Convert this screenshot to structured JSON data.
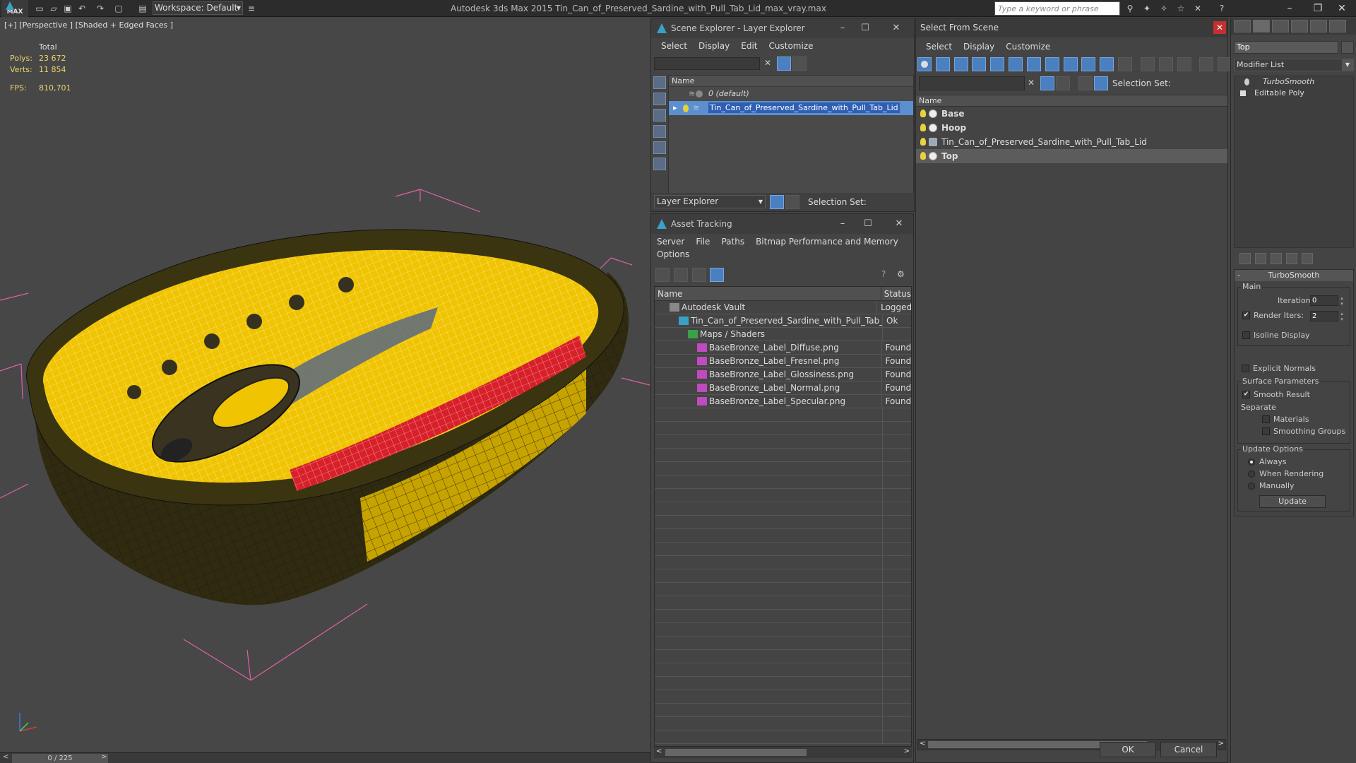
{
  "titlebar": {
    "app_name": "MAX",
    "workspace": "Workspace: Default",
    "title": "Autodesk 3ds Max  2015     Tin_Can_of_Preserved_Sardine_with_Pull_Tab_Lid_max_vray.max",
    "search_placeholder": "Type a keyword or phrase"
  },
  "viewport": {
    "label": "[+] [Perspective ] [Shaded + Edged Faces ]",
    "stats": {
      "total_label": "Total",
      "polys_label": "Polys:",
      "polys": "23 672",
      "verts_label": "Verts:",
      "verts": "11 854",
      "fps_label": "FPS:",
      "fps": "810,701"
    }
  },
  "timeslider": {
    "value": "0 / 225"
  },
  "scene_explorer": {
    "title": "Scene Explorer - Layer Explorer",
    "menu": [
      "Select",
      "Display",
      "Edit",
      "Customize"
    ],
    "col_name": "Name",
    "rows": [
      {
        "label": "0 (default)"
      },
      {
        "label": "Tin_Can_of_Preserved_Sardine_with_Pull_Tab_Lid"
      }
    ],
    "layer_dropdown": "Layer Explorer",
    "selection_set_label": "Selection Set:"
  },
  "asset_tracking": {
    "title": "Asset Tracking",
    "menu": [
      "Server",
      "File",
      "Paths",
      "Bitmap Performance and Memory"
    ],
    "menu2": "Options",
    "col_name": "Name",
    "col_status": "Status",
    "rows": [
      {
        "name": "Autodesk Vault",
        "status": "Logged",
        "indent": 1
      },
      {
        "name": "Tin_Can_of_Preserved_Sardine_with_Pull_Tab_Lid...",
        "status": "Ok",
        "indent": 2
      },
      {
        "name": "Maps / Shaders",
        "status": "",
        "indent": 3
      },
      {
        "name": "BaseBronze_Label_Diffuse.png",
        "status": "Found",
        "indent": 4
      },
      {
        "name": "BaseBronze_Label_Fresnel.png",
        "status": "Found",
        "indent": 4
      },
      {
        "name": "BaseBronze_Label_Glossiness.png",
        "status": "Found",
        "indent": 4
      },
      {
        "name": "BaseBronze_Label_Normal.png",
        "status": "Found",
        "indent": 4
      },
      {
        "name": "BaseBronze_Label_Specular.png",
        "status": "Found",
        "indent": 4
      }
    ]
  },
  "select_from_scene": {
    "title": "Select From Scene",
    "menu": [
      "Select",
      "Display",
      "Customize"
    ],
    "selection_set_label": "Selection Set:",
    "col_name": "Name",
    "rows": [
      {
        "label": "Base",
        "bold": true
      },
      {
        "label": "Hoop",
        "bold": true
      },
      {
        "label": "Tin_Can_of_Preserved_Sardine_with_Pull_Tab_Lid",
        "bold": false
      },
      {
        "label": "Top",
        "bold": true
      }
    ],
    "ok": "OK",
    "cancel": "Cancel"
  },
  "command_panel": {
    "object_name": "Top",
    "modifier_list": "Modifier List",
    "stack": [
      "TurboSmooth",
      "Editable Poly"
    ],
    "turbosmooth": {
      "title": "TurboSmooth",
      "main_label": "Main",
      "iterations_label": "Iterations:",
      "iterations": "0",
      "render_iters_label": "Render Iters:",
      "render_iters": "2",
      "isoline": "Isoline Display",
      "explicit_normals": "Explicit Normals",
      "surface_params": "Surface Parameters",
      "smooth_result": "Smooth Result",
      "separate": "Separate",
      "materials": "Materials",
      "smoothing_groups": "Smoothing Groups",
      "update_options": "Update Options",
      "always": "Always",
      "when_rendering": "When Rendering",
      "manually": "Manually",
      "update": "Update"
    }
  },
  "colors": {
    "selection_blue": "#2f5fb3",
    "label_yellow": "#f0c400",
    "label_red": "#d8202a",
    "bounding_box": "#e060a8"
  }
}
